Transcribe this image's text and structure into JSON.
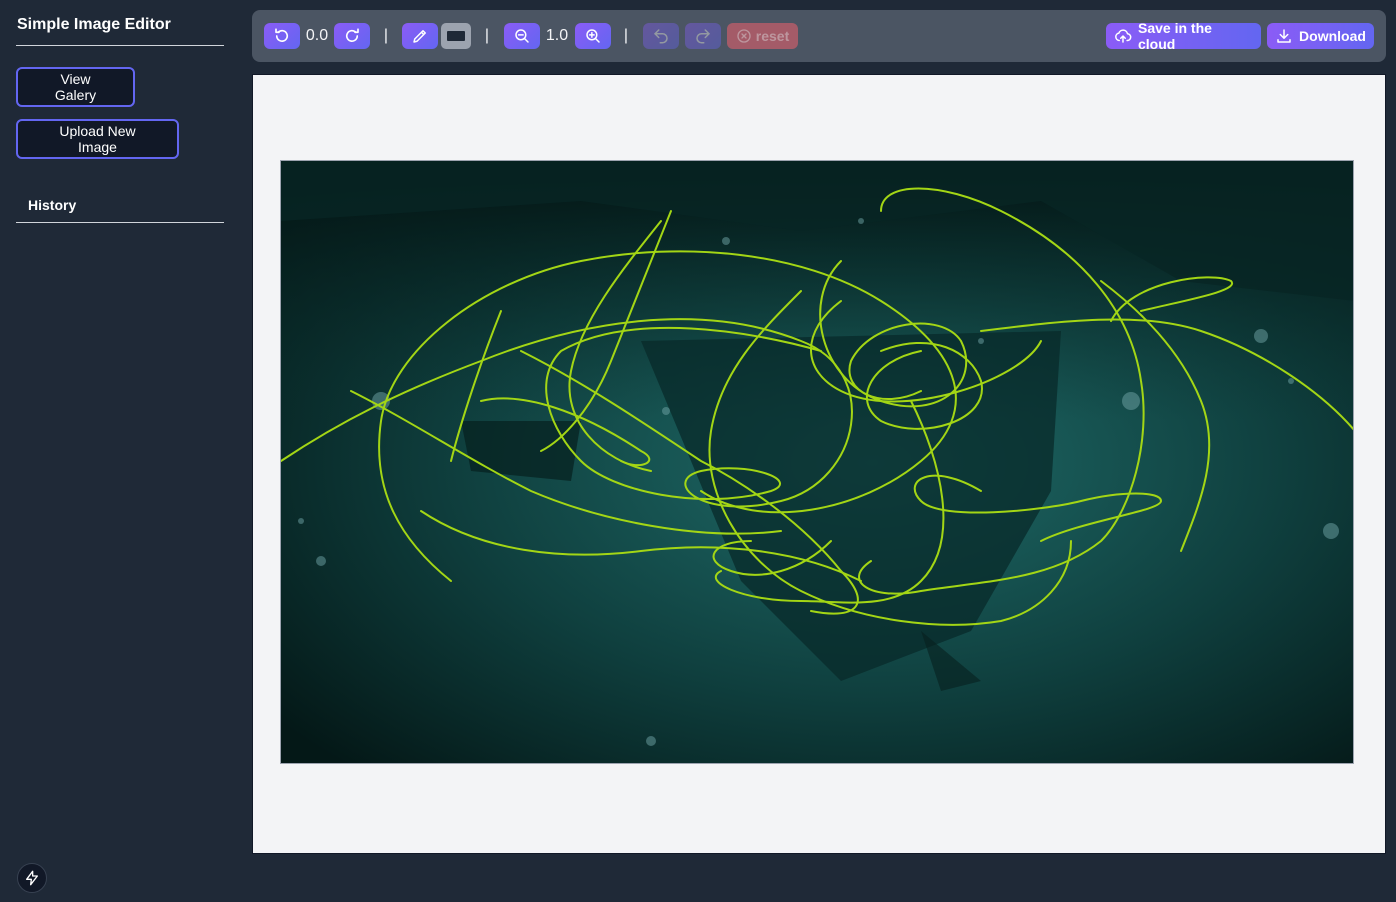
{
  "app": {
    "title": "Simple Image Editor"
  },
  "sidebar": {
    "buttons": {
      "view_gallery": "View Galery",
      "upload_new": "Upload New Image"
    },
    "history_label": "History"
  },
  "toolbar": {
    "rotation_value": "0.0",
    "zoom_value": "1.0",
    "separator": "|",
    "reset_label": "reset",
    "save_cloud_label": "Save in the cloud",
    "download_label": "Download",
    "brush_color": "#1f2937",
    "accent_gradient": [
      "#8b5cf6",
      "#6366f1"
    ],
    "icons": [
      "rotate-left-icon",
      "rotate-right-icon",
      "pencil-icon",
      "color-swatch",
      "zoom-out-icon",
      "zoom-in-icon",
      "undo-icon",
      "redo-icon",
      "reset-icon",
      "cloud-upload-icon",
      "download-icon"
    ]
  },
  "canvas": {
    "stroke_color": "#a3d615",
    "background": "#f3f4f6"
  }
}
